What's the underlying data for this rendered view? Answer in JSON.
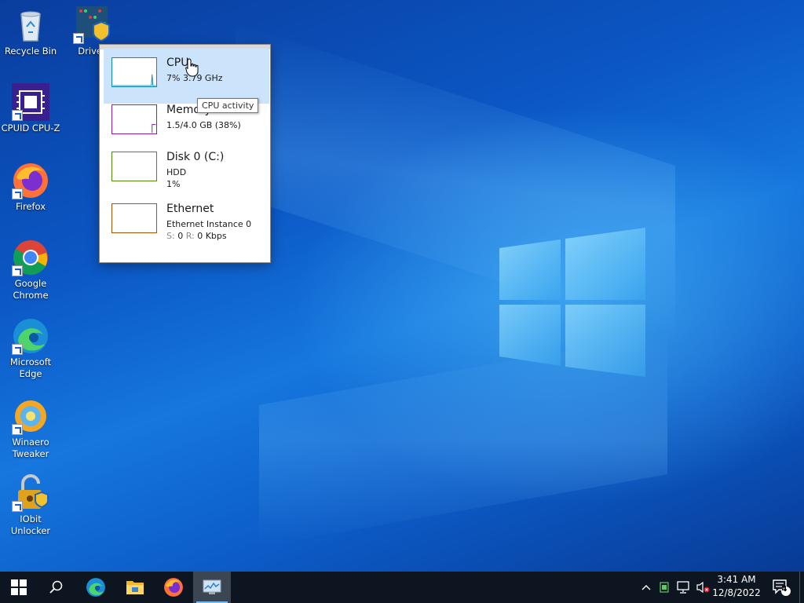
{
  "desktop_icons": [
    {
      "label": "Recycle Bin"
    },
    {
      "label": "Driver"
    },
    {
      "label": "CPUID CPU-Z"
    },
    {
      "label": "Firefox"
    },
    {
      "label": "Google Chrome"
    },
    {
      "label": "Microsoft Edge"
    },
    {
      "label": "Winaero Tweaker"
    },
    {
      "label": "IObit Unlocker"
    }
  ],
  "flyout": {
    "items": [
      {
        "name": "CPU",
        "line1": "7% 3.79 GHz",
        "line2": "",
        "color": "#1187b8"
      },
      {
        "name": "Memory",
        "line1": "1.5/4.0 GB (38%)",
        "line2": "",
        "color": "#8b1da8"
      },
      {
        "name": "Disk 0 (C:)",
        "line1": "HDD",
        "line2": "1%",
        "color": "#4e8a0f"
      },
      {
        "name": "Ethernet",
        "line1": "Ethernet Instance 0",
        "line2_s": "S:",
        "line2_sv": "0",
        "line2_r": "R:",
        "line2_rv": "0 Kbps",
        "color": "#a7520b"
      }
    ],
    "tooltip": "CPU activity"
  },
  "taskbar": {
    "clock_time": "3:41 AM",
    "clock_date": "12/8/2022",
    "notification_count": "4"
  }
}
